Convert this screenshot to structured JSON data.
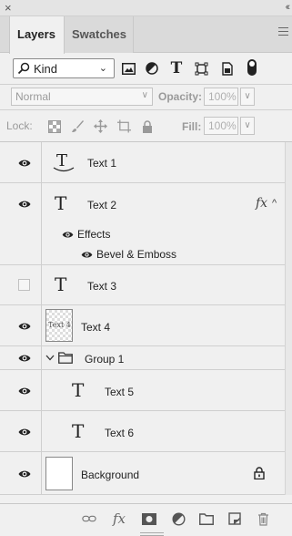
{
  "window": {
    "close_glyph": "×",
    "collapse_glyph": "‹‹"
  },
  "tabs": [
    {
      "label": "Layers",
      "active": true
    },
    {
      "label": "Swatches",
      "active": false
    }
  ],
  "filter": {
    "kind_label": "Kind",
    "kind_icons": [
      "pixel-layer-filter-icon",
      "adjustment-layer-filter-icon",
      "type-layer-filter-icon",
      "shape-layer-filter-icon",
      "smart-object-filter-icon"
    ],
    "type_glyph": "T"
  },
  "blend": {
    "mode": "Normal",
    "opacity_label": "Opacity:",
    "opacity_value": "100%"
  },
  "lock": {
    "label": "Lock:",
    "fill_label": "Fill:",
    "fill_value": "100%"
  },
  "layers": [
    {
      "name": "Text 1",
      "kind": "warped-text",
      "visible": true
    },
    {
      "name": "Text 2",
      "kind": "text",
      "visible": true,
      "fx": "fx",
      "effects_label": "Effects",
      "effect_items": [
        "Bevel & Emboss"
      ]
    },
    {
      "name": "Text 3",
      "kind": "text",
      "visible": false
    },
    {
      "name": "Text 4",
      "kind": "rasterized",
      "visible": true,
      "thumb_text": "Text 4"
    },
    {
      "name": "Group 1",
      "kind": "group",
      "visible": true,
      "expanded": true
    },
    {
      "name": "Text 5",
      "kind": "text",
      "visible": true,
      "indented": true
    },
    {
      "name": "Text 6",
      "kind": "text",
      "visible": true,
      "indented": true
    },
    {
      "name": "Background",
      "kind": "background",
      "visible": true,
      "locked": true
    }
  ],
  "glyphs": {
    "type_T": "T",
    "chevron_down": "⌄",
    "caret_up": "^",
    "chevron_down_v": "∨"
  },
  "bottom_icons": [
    "link-layers-icon",
    "layer-style-icon",
    "add-mask-icon",
    "new-adjustment-icon",
    "new-group-icon",
    "new-layer-icon",
    "delete-layer-icon"
  ],
  "colors": {
    "panel_bg": "#f0f0f0",
    "tab_bar_bg": "#dadada",
    "text": "#222222",
    "muted": "#9a9a9a"
  }
}
